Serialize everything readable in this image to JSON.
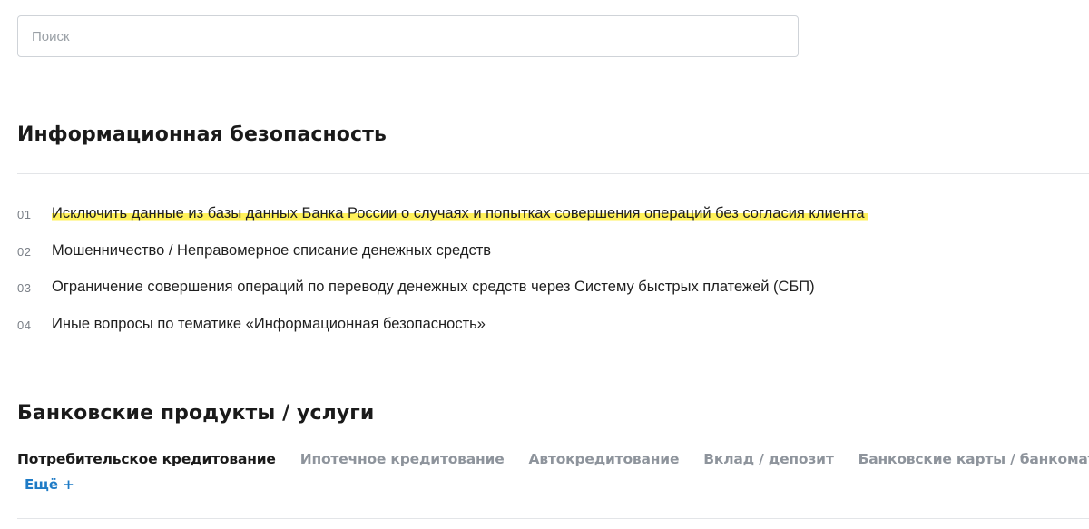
{
  "search": {
    "placeholder": "Поиск",
    "value": ""
  },
  "security": {
    "title": "Информационная безопасность",
    "items": [
      {
        "num": "01",
        "label": "Исключить данные из базы данных Банка России о случаях и попытках совершения операций без согласия клиента",
        "highlighted": true
      },
      {
        "num": "02",
        "label": "Мошенничество / Неправомерное списание денежных средств"
      },
      {
        "num": "03",
        "label": "Ограничение совершения операций по переводу денежных средств через Систему быстрых платежей (СБП)"
      },
      {
        "num": "04",
        "label": "Иные вопросы по тематике «Информационная безопасность»"
      }
    ]
  },
  "products": {
    "title": "Банковские продукты / услуги",
    "tabs": [
      {
        "label": "Потребительское кредитование",
        "active": true
      },
      {
        "label": "Ипотечное кредитование"
      },
      {
        "label": "Автокредитование"
      },
      {
        "label": "Вклад / депозит"
      },
      {
        "label": "Банковские карты / банкоматы"
      }
    ],
    "more_label": "Ещё +"
  },
  "colors": {
    "highlight": "#fff15a",
    "link": "#1e7bc6",
    "inactive_tab": "#8e949c"
  }
}
